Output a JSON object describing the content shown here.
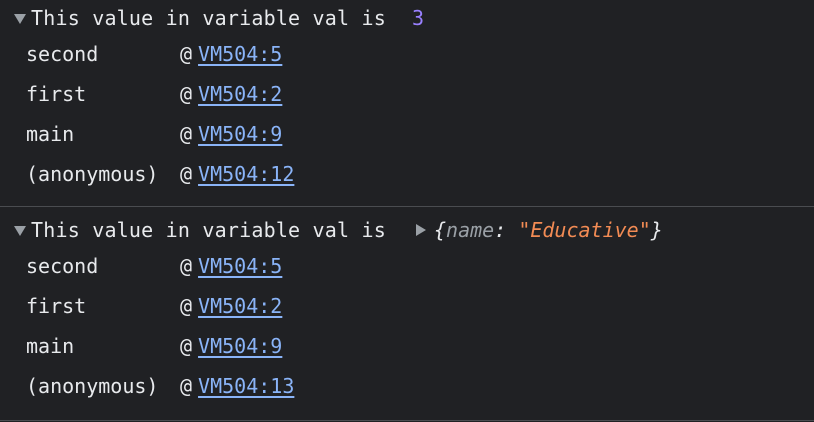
{
  "entries": [
    {
      "message": "This value in variable val is",
      "value_number": "3",
      "frames": [
        {
          "fn": "second",
          "at": "@",
          "loc": "VM504:5"
        },
        {
          "fn": "first",
          "at": "@",
          "loc": "VM504:2"
        },
        {
          "fn": "main",
          "at": "@",
          "loc": "VM504:9"
        },
        {
          "fn": "(anonymous)",
          "at": "@",
          "loc": "VM504:12"
        }
      ]
    },
    {
      "message": "This value in variable val is",
      "object_preview": {
        "open": "{",
        "key": "name",
        "colon": ": ",
        "value": "\"Educative\"",
        "close": "}"
      },
      "frames": [
        {
          "fn": "second",
          "at": "@",
          "loc": "VM504:5"
        },
        {
          "fn": "first",
          "at": "@",
          "loc": "VM504:2"
        },
        {
          "fn": "main",
          "at": "@",
          "loc": "VM504:9"
        },
        {
          "fn": "(anonymous)",
          "at": "@",
          "loc": "VM504:13"
        }
      ]
    }
  ],
  "colors": {
    "background": "#202124",
    "text": "#e8eaed",
    "number": "#9980ff",
    "string": "#f28b54",
    "link": "#8ab4f8",
    "divider": "#4a4c50"
  },
  "icons": {
    "expand_open": "triangle-down-icon",
    "expand_closed": "triangle-right-icon"
  }
}
